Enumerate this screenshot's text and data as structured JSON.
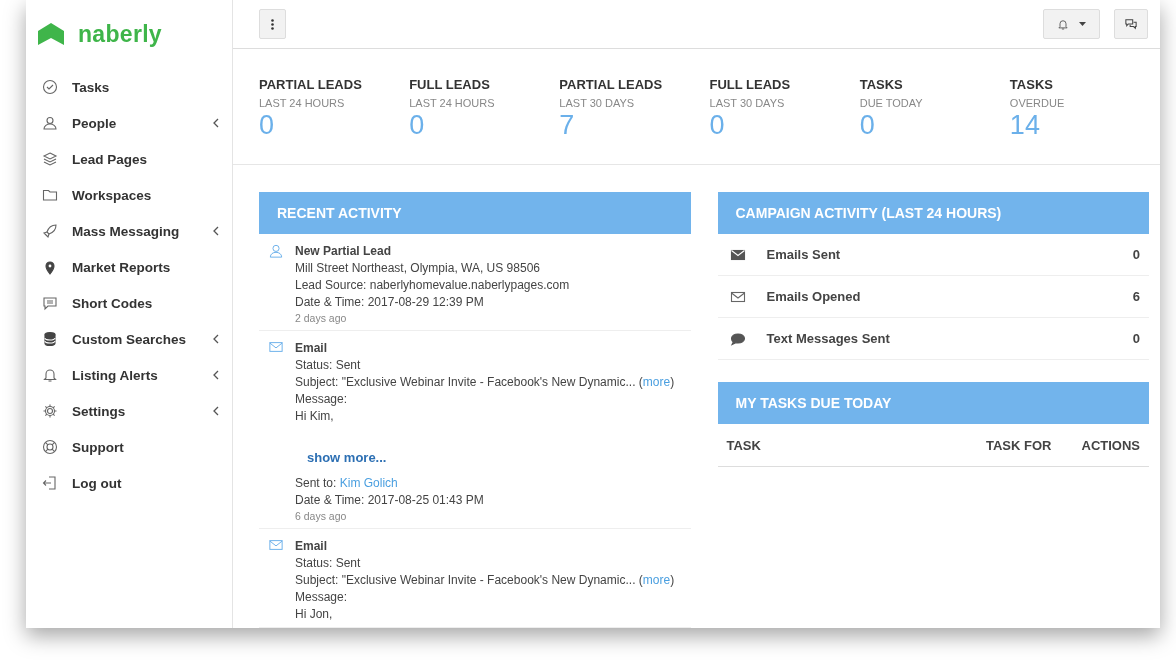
{
  "brand": {
    "name": "naberly"
  },
  "sidebar": {
    "items": [
      {
        "label": "Tasks",
        "has_submenu": false
      },
      {
        "label": "People",
        "has_submenu": true
      },
      {
        "label": "Lead Pages",
        "has_submenu": false
      },
      {
        "label": "Workspaces",
        "has_submenu": false
      },
      {
        "label": "Mass Messaging",
        "has_submenu": true
      },
      {
        "label": "Market Reports",
        "has_submenu": false
      },
      {
        "label": "Short Codes",
        "has_submenu": false
      },
      {
        "label": "Custom Searches",
        "has_submenu": true
      },
      {
        "label": "Listing Alerts",
        "has_submenu": true
      },
      {
        "label": "Settings",
        "has_submenu": true
      },
      {
        "label": "Support",
        "has_submenu": false
      },
      {
        "label": "Log out",
        "has_submenu": false
      }
    ]
  },
  "stats": [
    {
      "title": "PARTIAL LEADS",
      "subtitle": "LAST 24 HOURS",
      "value": "0"
    },
    {
      "title": "FULL LEADS",
      "subtitle": "LAST 24 HOURS",
      "value": "0"
    },
    {
      "title": "PARTIAL LEADS",
      "subtitle": "LAST 30 DAYS",
      "value": "7"
    },
    {
      "title": "FULL LEADS",
      "subtitle": "LAST 30 DAYS",
      "value": "0"
    },
    {
      "title": "TASKS",
      "subtitle": "DUE TODAY",
      "value": "0"
    },
    {
      "title": "TASKS",
      "subtitle": "OVERDUE",
      "value": "14"
    }
  ],
  "recent_activity": {
    "title": "RECENT ACTIVITY",
    "items": [
      {
        "kind": "lead",
        "title": "New Partial Lead",
        "lines": [
          {
            "kind": "text",
            "text": "Mill Street Northeast, Olympia, WA, US 98506"
          },
          {
            "kind": "text",
            "text": "Lead Source: naberlyhomevalue.naberlypages.com"
          },
          {
            "kind": "text",
            "text": "Date & Time: 2017-08-29 12:39 PM"
          }
        ],
        "ago": "2 days ago"
      },
      {
        "kind": "email",
        "title": "Email",
        "lines": [
          {
            "kind": "text",
            "text": "Status: Sent"
          },
          {
            "kind": "text",
            "text": "Subject: \"Exclusive Webinar Invite - Facebook's New Dynamic...",
            "link": {
              "before": "(",
              "text": "more",
              "after": ")"
            }
          },
          {
            "kind": "text",
            "text": "Message:"
          },
          {
            "kind": "text",
            "text": "Hi Kim,"
          },
          {
            "kind": "show_more",
            "text": "show more..."
          },
          {
            "kind": "text",
            "text": "Sent to:",
            "link": {
              "text": "Kim Golich"
            }
          },
          {
            "kind": "text",
            "text": "Date & Time: 2017-08-25 01:43 PM"
          }
        ],
        "ago": "6 days ago"
      },
      {
        "kind": "email",
        "title": "Email",
        "lines": [
          {
            "kind": "text",
            "text": "Status: Sent"
          },
          {
            "kind": "text",
            "text": "Subject: \"Exclusive Webinar Invite - Facebook's New Dynamic...",
            "link": {
              "before": "(",
              "text": "more",
              "after": ")"
            }
          },
          {
            "kind": "text",
            "text": "Message:"
          },
          {
            "kind": "text",
            "text": "Hi Jon,"
          }
        ]
      }
    ]
  },
  "campaign_activity": {
    "title": "CAMPAIGN ACTIVITY (LAST 24 HOURS)",
    "rows": [
      {
        "label": "Emails Sent",
        "value": "0"
      },
      {
        "label": "Emails Opened",
        "value": "6"
      },
      {
        "label": "Text Messages Sent",
        "value": "0"
      }
    ]
  },
  "tasks_due": {
    "title": "MY TASKS DUE TODAY",
    "columns": [
      "TASK",
      "TASK FOR",
      "ACTIONS"
    ]
  }
}
